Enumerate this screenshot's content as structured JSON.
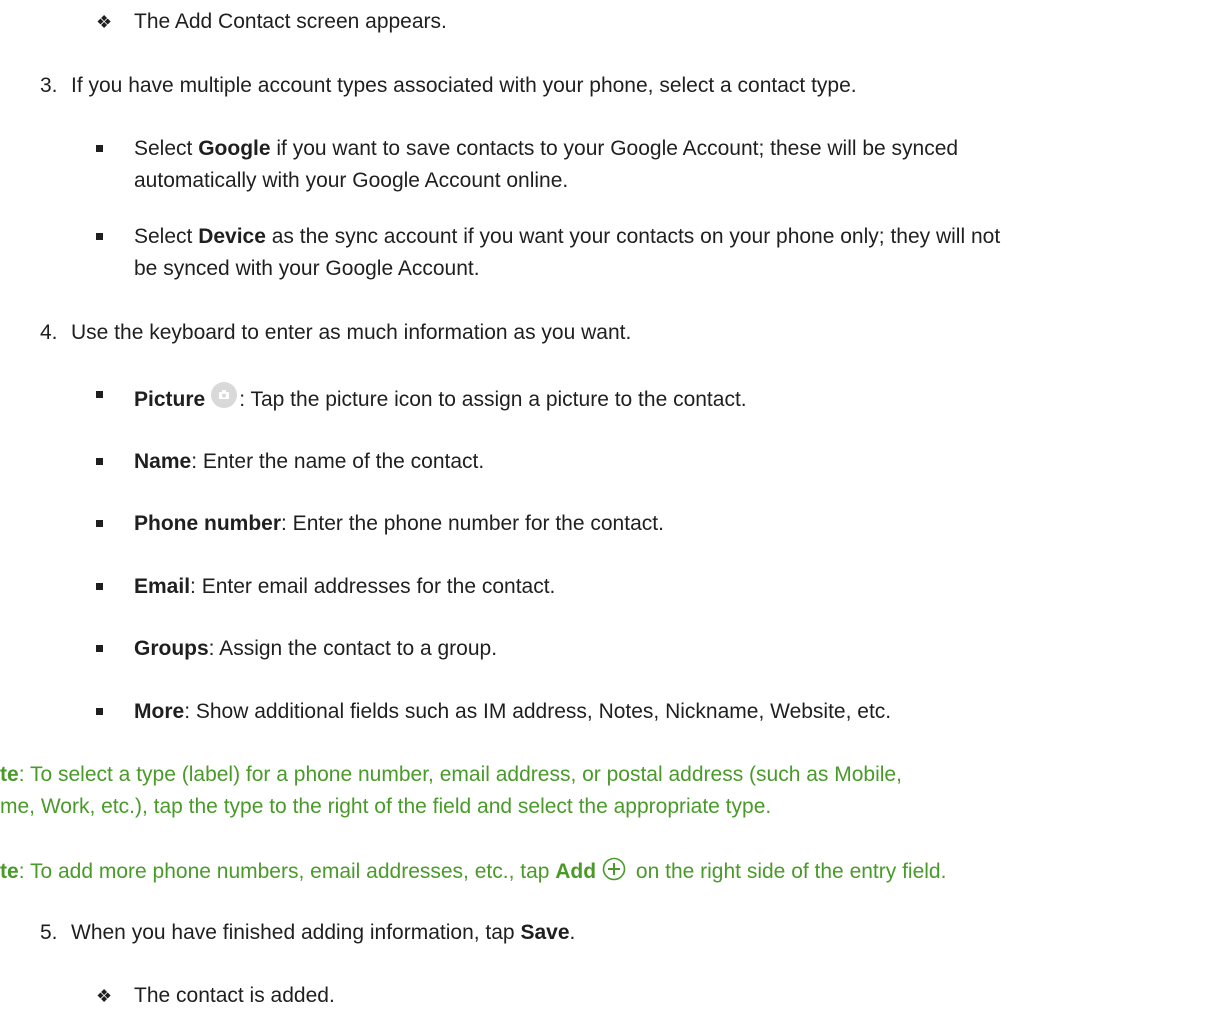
{
  "step2_result": "The Add Contact screen appears.",
  "step3": {
    "number": "3.",
    "text": "If you have multiple account types associated with your phone, select a contact type.",
    "google": {
      "pre": "Select ",
      "bold": "Google",
      "post": " if you want to save contacts to your Google Account; these will be synced",
      "line2": "automatically with your Google Account online."
    },
    "device": {
      "pre": "Select ",
      "bold": "Device",
      "post": " as the sync account if you want your contacts on your phone only; they will not",
      "line2": "be synced with your Google Account."
    }
  },
  "step4": {
    "number": "4.",
    "text": "Use the keyboard to enter as much information as you want.",
    "items": [
      {
        "bold": "Picture",
        "text": ": Tap the picture icon to assign a picture to the contact.",
        "icon": "camera-icon"
      },
      {
        "bold": "Name",
        "text": ": Enter the name of the contact."
      },
      {
        "bold": "Phone number",
        "text": ": Enter the phone number for the contact."
      },
      {
        "bold": "Email",
        "text": ": Enter email addresses for the contact."
      },
      {
        "bold": "Groups",
        "text": ": Assign the contact to a group."
      },
      {
        "bold": "More",
        "text": ": Show additional fields such as IM address, Notes, Nickname, Website, etc."
      }
    ]
  },
  "note1": {
    "bold": "te",
    "line1": ": To select a type (label) for a phone number, email address, or postal address (such as Mobile,",
    "line2": "me, Work, etc.), tap the type to the right of the field and select the appropriate type."
  },
  "note2": {
    "bold": "te",
    "pre": ": To add more phone numbers, email addresses, etc., tap ",
    "add": "Add",
    "post": " on the right side of the entry field.",
    "icon": "plus-circle-icon"
  },
  "step5": {
    "number": "5.",
    "pre": "When you have finished adding information, tap ",
    "bold": "Save",
    "post": "."
  },
  "step5_result": "The contact is added.",
  "colors": {
    "text": "#1f1f1f",
    "note": "#4a9a2a"
  }
}
